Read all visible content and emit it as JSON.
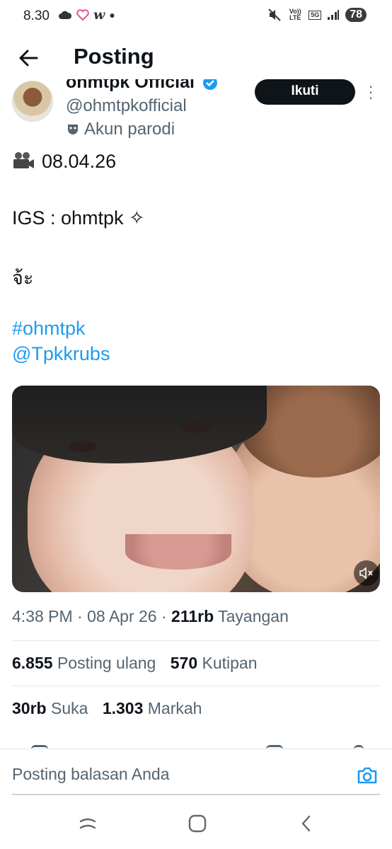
{
  "status_bar": {
    "time": "8.30",
    "left_icons": [
      "cloud-icon",
      "heart-icon",
      "w-app-icon",
      "dot-icon"
    ],
    "volte": "Vo)) LTE",
    "network": "5G",
    "battery": "78"
  },
  "header": {
    "title": "Posting"
  },
  "profile": {
    "display_name": "ohmtpk Official",
    "handle": "@ohmtpkofficial",
    "parody_label": "Akun parodi",
    "follow_label": "Ikuti"
  },
  "tweet": {
    "line1": "08.04.26",
    "line2": "IGS : ohmtpk ✧",
    "line3": "จ้ะ",
    "hashtag": "#ohmtpk",
    "mention": "@Tpkkrubs"
  },
  "meta": {
    "time": "4:38 PM",
    "date": "08 Apr 26",
    "views_count": "211rb",
    "views_label": "Tayangan"
  },
  "stats": {
    "reposts_count": "6.855",
    "reposts_label": "Posting ulang",
    "quotes_count": "570",
    "quotes_label": "Kutipan",
    "likes_count": "30rb",
    "likes_label": "Suka",
    "bookmarks_count": "1.303",
    "bookmarks_label": "Markah"
  },
  "reply": {
    "placeholder": "Posting balasan Anda"
  },
  "colors": {
    "link": "#1d9bf0",
    "text": "#0f1419",
    "secondary": "#536471",
    "follow_bg": "#0f1419"
  }
}
